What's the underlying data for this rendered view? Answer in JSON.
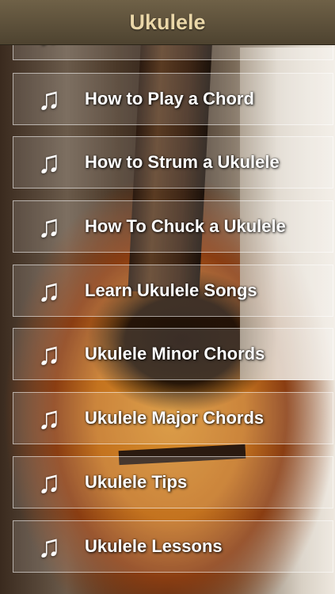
{
  "header": {
    "title": "Ukulele"
  },
  "menu": {
    "icon": "music-note-icon",
    "items": [
      {
        "label": "How to Play a Chord"
      },
      {
        "label": "How to Strum a Ukulele"
      },
      {
        "label": "How To Chuck a Ukulele"
      },
      {
        "label": "Learn Ukulele Songs"
      },
      {
        "label": "Ukulele Minor Chords"
      },
      {
        "label": "Ukulele Major Chords"
      },
      {
        "label": "Ukulele Tips"
      },
      {
        "label": "Ukulele Lessons"
      }
    ]
  }
}
